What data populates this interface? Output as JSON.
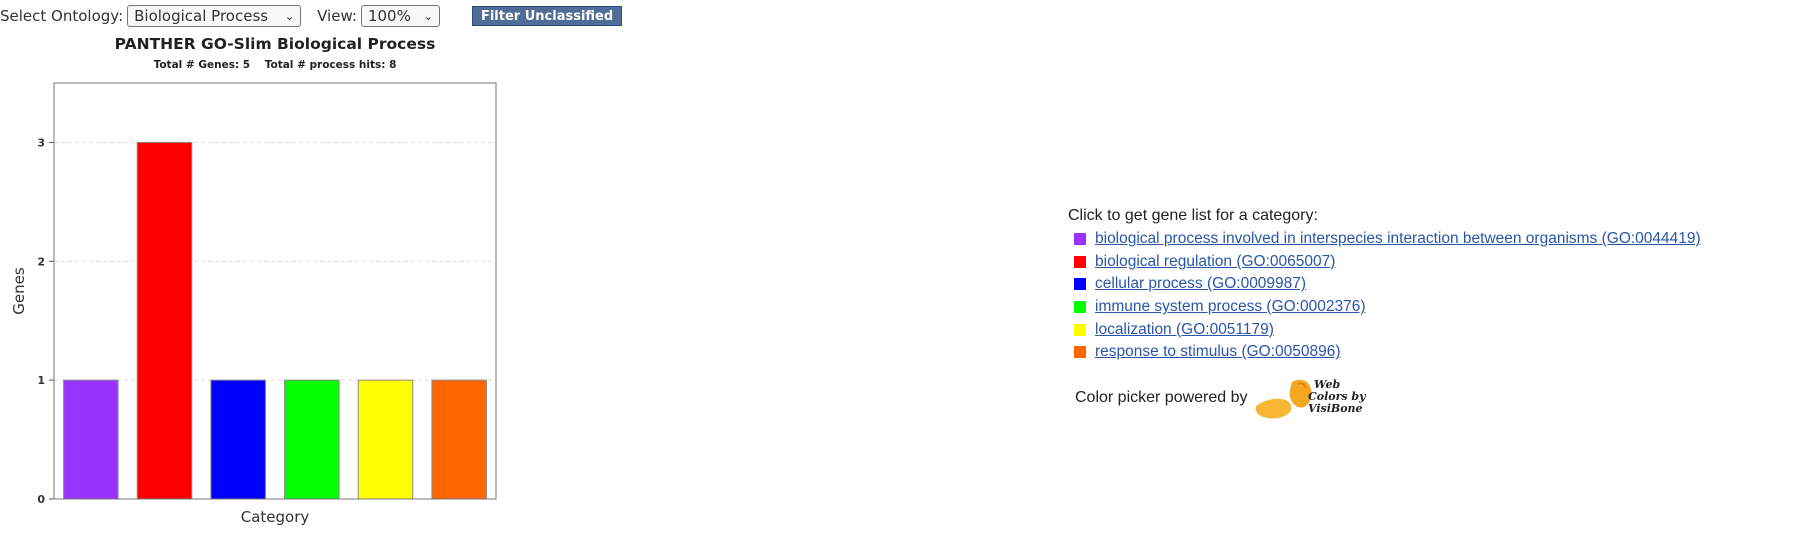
{
  "controls": {
    "ontology_label": "Select Ontology:",
    "ontology_value": "Biological Process",
    "view_label": "View:",
    "view_value": "100%",
    "filter_button": "Filter Unclassified"
  },
  "chart_data": {
    "type": "bar",
    "title": "PANTHER GO-Slim Biological Process",
    "subtitle": "Total # Genes: 5    Total # process hits: 8",
    "xlabel": "Category",
    "ylabel": "Genes",
    "ylim": [
      0,
      3.5
    ],
    "yticks": [
      0,
      1,
      2,
      3
    ],
    "grid": true,
    "categories": [
      "biological process involved in interspecies interaction between organisms (GO:0044419)",
      "biological regulation (GO:0065007)",
      "cellular process (GO:0009987)",
      "immune system process (GO:0002376)",
      "localization (GO:0051179)",
      "response to stimulus (GO:0050896)"
    ],
    "values": [
      1,
      3,
      1,
      1,
      1,
      1
    ],
    "colors": [
      "#9933FF",
      "#FF0000",
      "#0000FF",
      "#00FF00",
      "#FFFF00",
      "#FF6600"
    ]
  },
  "legend": {
    "title": "Click to get gene list for a category:",
    "items": [
      {
        "label": "biological process involved in interspecies interaction between organisms (GO:0044419)",
        "color": "#9933FF"
      },
      {
        "label": "biological regulation (GO:0065007)",
        "color": "#FF0000"
      },
      {
        "label": "cellular process (GO:0009987)",
        "color": "#0000FF"
      },
      {
        "label": "immune system process (GO:0002376)",
        "color": "#00FF00"
      },
      {
        "label": "localization (GO:0051179)",
        "color": "#FFFF00"
      },
      {
        "label": "response to stimulus (GO:0050896)",
        "color": "#FF6600"
      }
    ]
  },
  "footer": {
    "powered_by": "Color picker powered by",
    "logo_text": [
      "Web",
      "Colors by",
      "VisiBone"
    ]
  }
}
